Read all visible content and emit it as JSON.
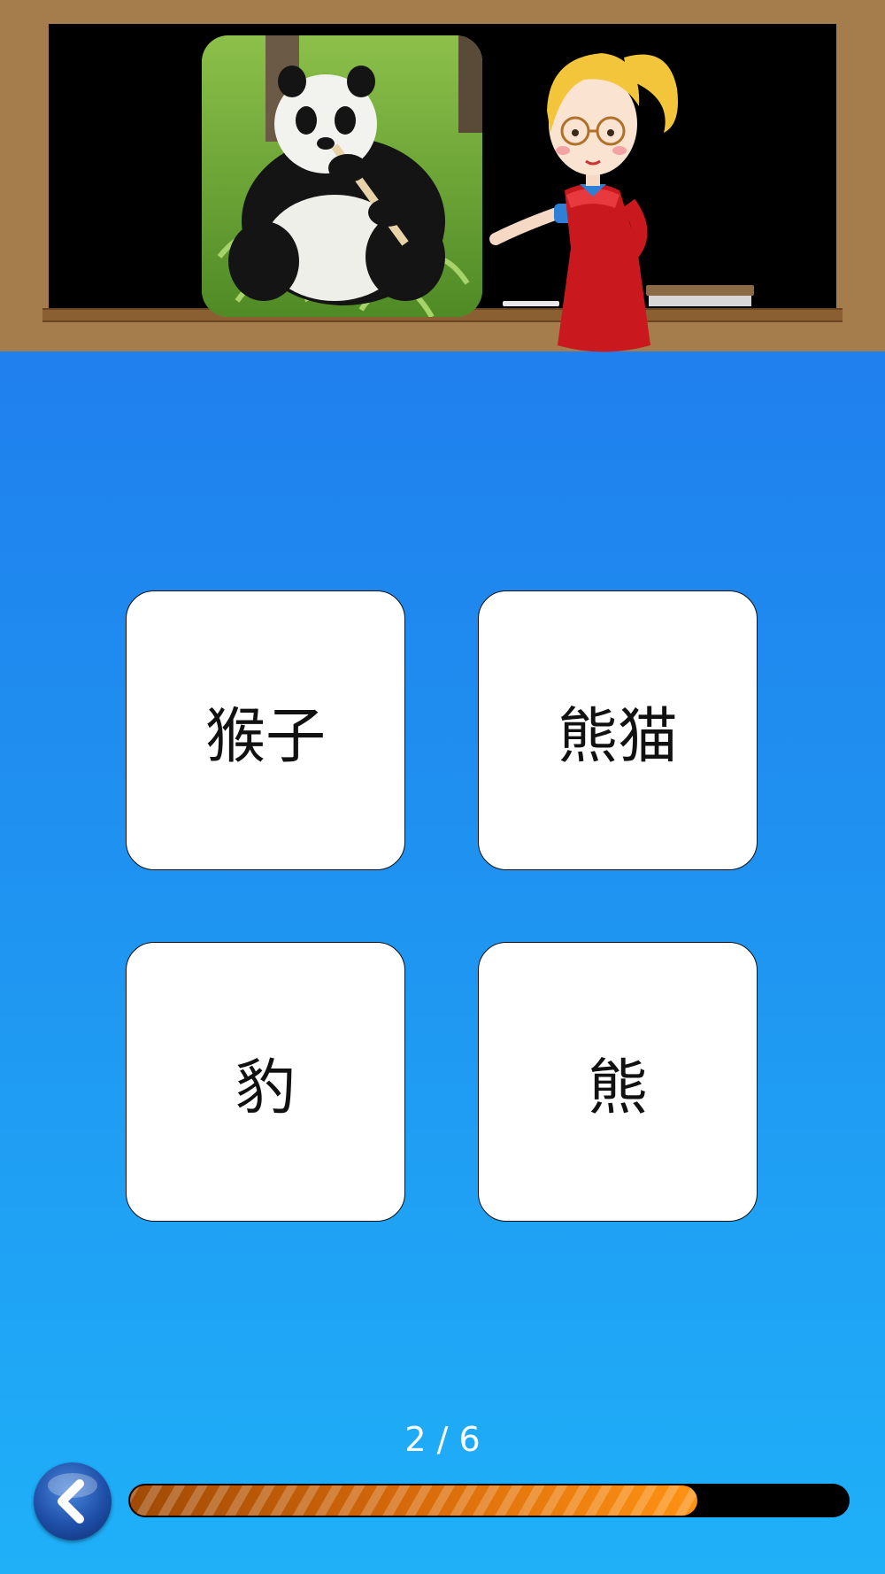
{
  "header": {
    "image_subject": "giant-panda-photo",
    "character": "teacher-illustration"
  },
  "answers": [
    {
      "label": "猴子"
    },
    {
      "label": "熊猫"
    },
    {
      "label": "豹"
    },
    {
      "label": "熊"
    }
  ],
  "progress": {
    "counter_text": "2 / 6",
    "fill_fraction": 0.79
  },
  "icons": {
    "back": "chevron-left-icon"
  },
  "colors": {
    "background_top": "#1f73ec",
    "background_bottom": "#1fb0f8",
    "progress_fill": "#ff9212",
    "frame": "#a57d4d"
  }
}
